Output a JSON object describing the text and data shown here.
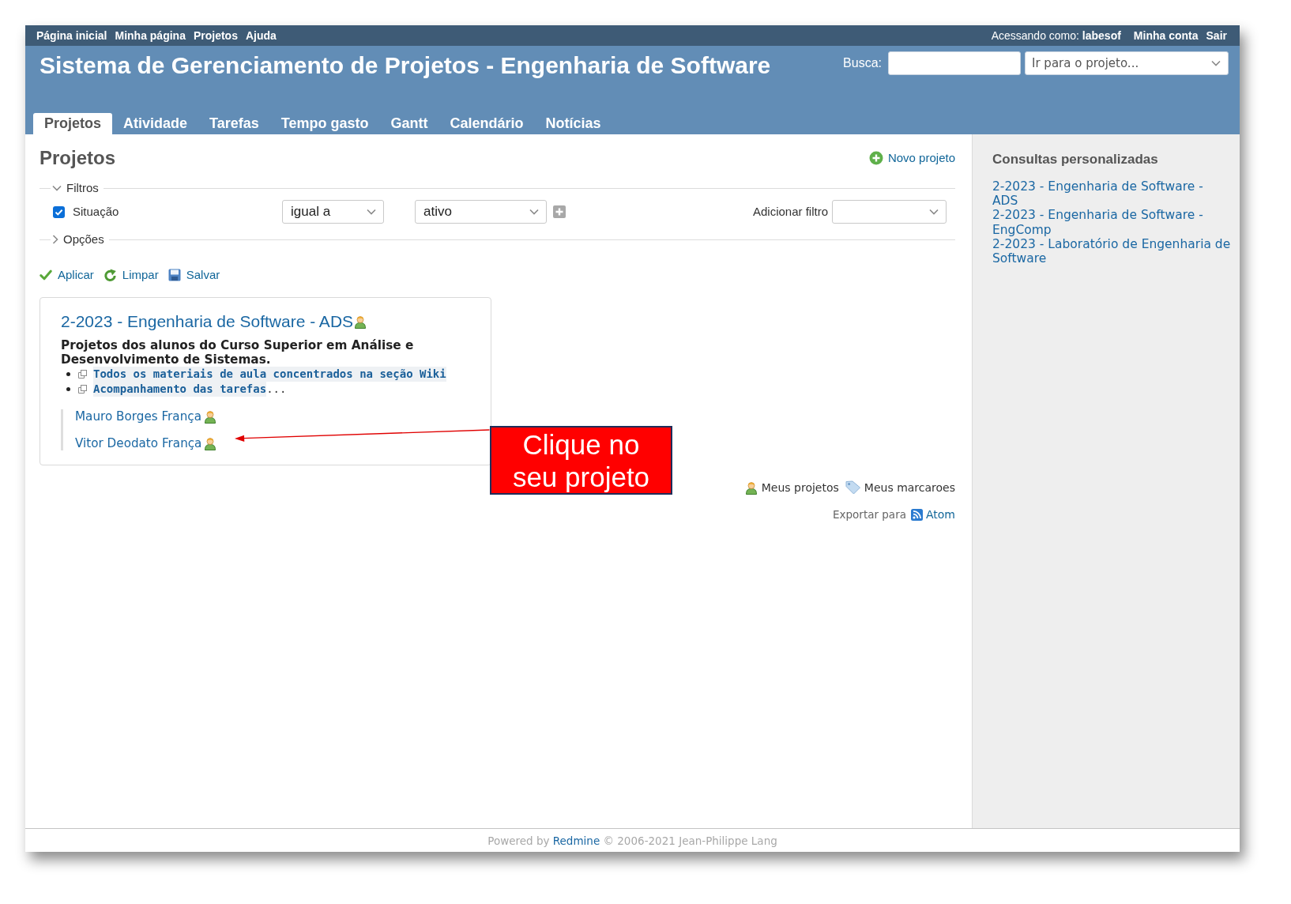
{
  "top_menu": {
    "items": [
      {
        "label": "Página inicial"
      },
      {
        "label": "Minha página"
      },
      {
        "label": "Projetos"
      },
      {
        "label": "Ajuda"
      }
    ],
    "logged_in_as": "Acessando como:",
    "user": "labesof",
    "account_items": [
      {
        "label": "Minha conta"
      },
      {
        "label": "Sair"
      }
    ]
  },
  "header": {
    "title": "Sistema de Gerenciamento de Projetos - Engenharia de Software",
    "search_label": "Busca:",
    "project_jump": {
      "value": "Ir para o projeto..."
    }
  },
  "tabs": [
    {
      "label": "Projetos",
      "selected": true
    },
    {
      "label": "Atividade",
      "selected": false
    },
    {
      "label": "Tarefas",
      "selected": false
    },
    {
      "label": "Tempo gasto",
      "selected": false
    },
    {
      "label": "Gantt",
      "selected": false
    },
    {
      "label": "Calendário",
      "selected": false
    },
    {
      "label": "Notícias",
      "selected": false
    }
  ],
  "content": {
    "heading": "Projetos",
    "new_project": "Novo projeto",
    "filters": {
      "legend": "Filtros",
      "expanded": true,
      "rows": [
        {
          "label": "Situação",
          "checked": true,
          "operator": "igual a",
          "value": "ativo"
        }
      ],
      "add_filter_label": "Adicionar filtro"
    },
    "options": {
      "legend": "Opções",
      "expanded": false
    },
    "actions": [
      {
        "kind": "apply",
        "label": "Aplicar"
      },
      {
        "kind": "clear",
        "label": "Limpar"
      },
      {
        "kind": "save",
        "label": "Salvar"
      }
    ],
    "projects": [
      {
        "title": "2-2023 - Engenharia de Software - ADS",
        "member": true,
        "description": "Projetos dos alunos do Curso Superior em Análise e Desenvolvimento de Sistemas.",
        "links": [
          {
            "text": "Todos os materiais de aula concentrados na seção Wiki"
          },
          {
            "text": "Acompanhamento das tarefas",
            "trailing": "..."
          }
        ],
        "children": [
          {
            "title": "Mauro Borges França",
            "member": true
          },
          {
            "title": "Vitor Deodato França",
            "member": true
          }
        ]
      }
    ],
    "legend": [
      {
        "kind": "my_projects",
        "label": "Meus projetos"
      },
      {
        "kind": "bookmarks",
        "label": "Meus marcaroes"
      }
    ],
    "export": {
      "label": "Exportar para",
      "link": "Atom"
    }
  },
  "sidebar": {
    "title": "Consultas personalizadas",
    "queries": [
      {
        "label": "2-2023 - Engenharia de Software - ADS"
      },
      {
        "label": "2-2023 - Engenharia de Software - EngComp"
      },
      {
        "label": "2-2023 - Laboratório de Engenharia de Software"
      }
    ]
  },
  "footer": {
    "prefix": "Powered by",
    "link": "Redmine",
    "suffix": "© 2006-2021 Jean-Philippe Lang"
  },
  "callout": {
    "text": "Clique no seu projeto"
  }
}
